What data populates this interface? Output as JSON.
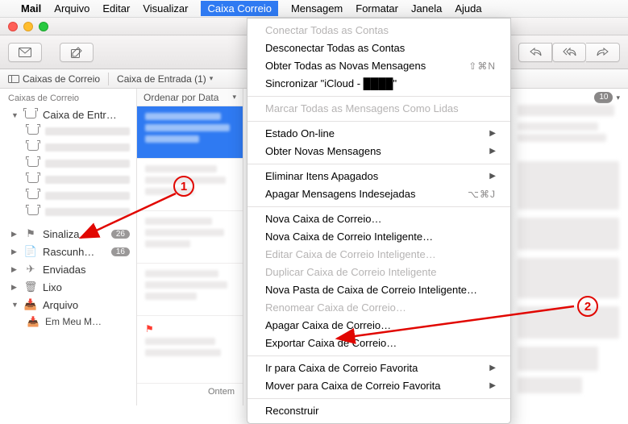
{
  "menubar": {
    "app": "Mail",
    "items": [
      "Arquivo",
      "Editar",
      "Visualizar",
      "Caixa Correio",
      "Mensagem",
      "Formatar",
      "Janela",
      "Ajuda"
    ],
    "selected_index": 3
  },
  "favbar": {
    "left_icon": "sidebar-toggle",
    "left_label": "Caixas de Correio",
    "mid_label": "Caixa de Entrada (1)",
    "right_count": "10"
  },
  "sidebar": {
    "header": "Caixas de Correio",
    "inbox_label": "Caixa de Entr…",
    "flagged_label": "Sinaliza…",
    "flagged_count": "26",
    "drafts_label": "Rascunh…",
    "drafts_count": "16",
    "sent_label": "Enviadas",
    "trash_label": "Lixo",
    "archive_label": "Arquivo",
    "archive_sub": "Em Meu M…"
  },
  "msglist": {
    "sort_label": "Ordenar por Data",
    "bottom_date": "Ontem"
  },
  "menu": {
    "g1": [
      {
        "label": "Conectar Todas as Contas",
        "disabled": true
      },
      {
        "label": "Desconectar Todas as Contas"
      },
      {
        "label": "Obter Todas as Novas Mensagens",
        "shortcut": "⇧⌘N"
      },
      {
        "label": "Sincronizar \"iCloud - ████\""
      }
    ],
    "g2": [
      {
        "label": "Marcar Todas as Mensagens Como Lidas",
        "disabled": true
      }
    ],
    "g3": [
      {
        "label": "Estado On-line",
        "submenu": true
      },
      {
        "label": "Obter Novas Mensagens",
        "submenu": true
      }
    ],
    "g4": [
      {
        "label": "Eliminar Itens Apagados",
        "submenu": true
      },
      {
        "label": "Apagar Mensagens Indesejadas",
        "shortcut": "⌥⌘J"
      }
    ],
    "g5": [
      {
        "label": "Nova Caixa de Correio…"
      },
      {
        "label": "Nova Caixa de Correio Inteligente…"
      },
      {
        "label": "Editar Caixa de Correio Inteligente…",
        "disabled": true
      },
      {
        "label": "Duplicar Caixa de Correio Inteligente",
        "disabled": true
      },
      {
        "label": "Nova Pasta de Caixa de Correio Inteligente…"
      },
      {
        "label": "Renomear Caixa de Correio…",
        "disabled": true
      },
      {
        "label": "Apagar Caixa de Correio…"
      },
      {
        "label": "Exportar Caixa de Correio…"
      }
    ],
    "g6": [
      {
        "label": "Ir para Caixa de Correio Favorita",
        "submenu": true
      },
      {
        "label": "Mover para Caixa de Correio Favorita",
        "submenu": true
      }
    ],
    "g7": [
      {
        "label": "Reconstruir"
      }
    ]
  },
  "callouts": {
    "one": "1",
    "two": "2"
  }
}
